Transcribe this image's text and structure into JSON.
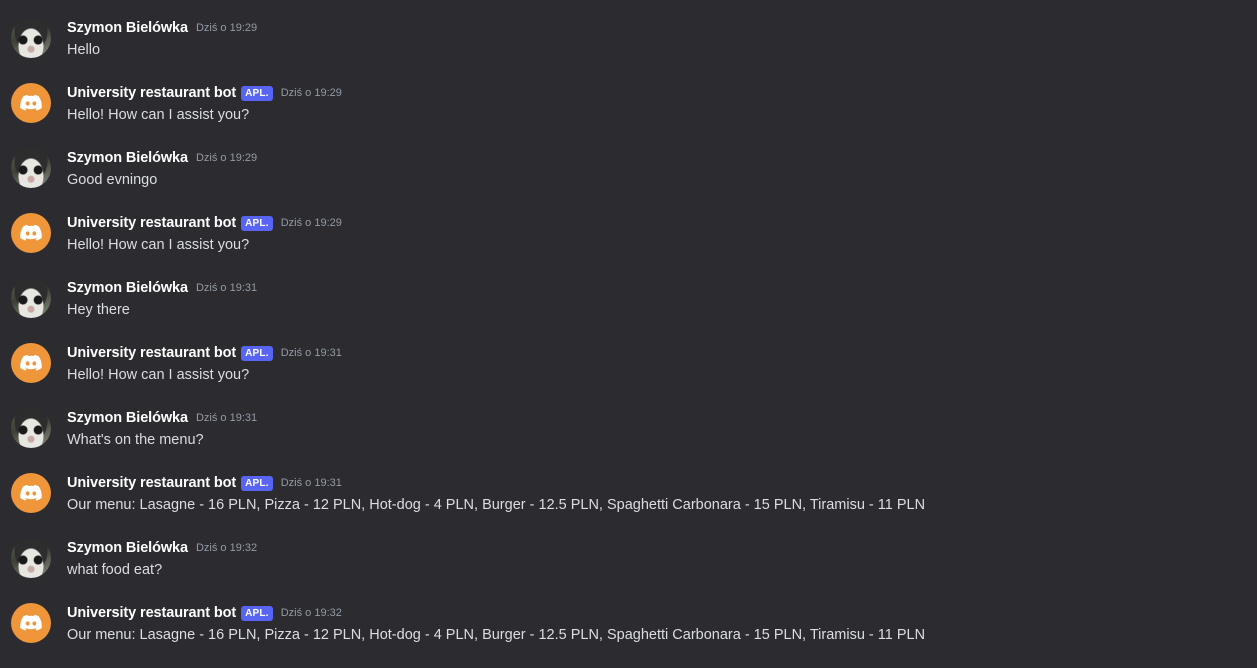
{
  "messages": [
    {
      "author": "Szymon Bielówka",
      "badge": "",
      "timestamp": "Dziś o 19:29",
      "text": "Hello",
      "avatar": "cat-avatar"
    },
    {
      "author": "University restaurant bot",
      "badge": "APL.",
      "timestamp": "Dziś o 19:29",
      "text": "Hello! How can I assist you?",
      "avatar": "discord-bot-avatar"
    },
    {
      "author": "Szymon Bielówka",
      "badge": "",
      "timestamp": "Dziś o 19:29",
      "text": "Good evningo",
      "avatar": "cat-avatar"
    },
    {
      "author": "University restaurant bot",
      "badge": "APL.",
      "timestamp": "Dziś o 19:29",
      "text": "Hello! How can I assist you?",
      "avatar": "discord-bot-avatar"
    },
    {
      "author": "Szymon Bielówka",
      "badge": "",
      "timestamp": "Dziś o 19:31",
      "text": "Hey there",
      "avatar": "cat-avatar"
    },
    {
      "author": "University restaurant bot",
      "badge": "APL.",
      "timestamp": "Dziś o 19:31",
      "text": "Hello! How can I assist you?",
      "avatar": "discord-bot-avatar"
    },
    {
      "author": "Szymon Bielówka",
      "badge": "",
      "timestamp": "Dziś o 19:31",
      "text": "What's on the menu?",
      "avatar": "cat-avatar"
    },
    {
      "author": "University restaurant bot",
      "badge": "APL.",
      "timestamp": "Dziś o 19:31",
      "text": "Our menu: Lasagne - 16 PLN, Pizza - 12 PLN, Hot-dog - 4 PLN, Burger - 12.5 PLN, Spaghetti Carbonara - 15 PLN, Tiramisu - 11 PLN",
      "avatar": "discord-bot-avatar"
    },
    {
      "author": "Szymon Bielówka",
      "badge": "",
      "timestamp": "Dziś o 19:32",
      "text": "what food eat?",
      "avatar": "cat-avatar"
    },
    {
      "author": "University restaurant bot",
      "badge": "APL.",
      "timestamp": "Dziś o 19:32",
      "text": "Our menu: Lasagne - 16 PLN, Pizza - 12 PLN, Hot-dog - 4 PLN, Burger - 12.5 PLN, Spaghetti Carbonara - 15 PLN, Tiramisu - 11 PLN",
      "avatar": "discord-bot-avatar"
    }
  ],
  "colors": {
    "background": "#2b2b30",
    "bot_avatar": "#f0963a",
    "badge": "#5865f2",
    "author": "#ffffff",
    "text": "#dbdee1",
    "timestamp": "#949ba4"
  }
}
